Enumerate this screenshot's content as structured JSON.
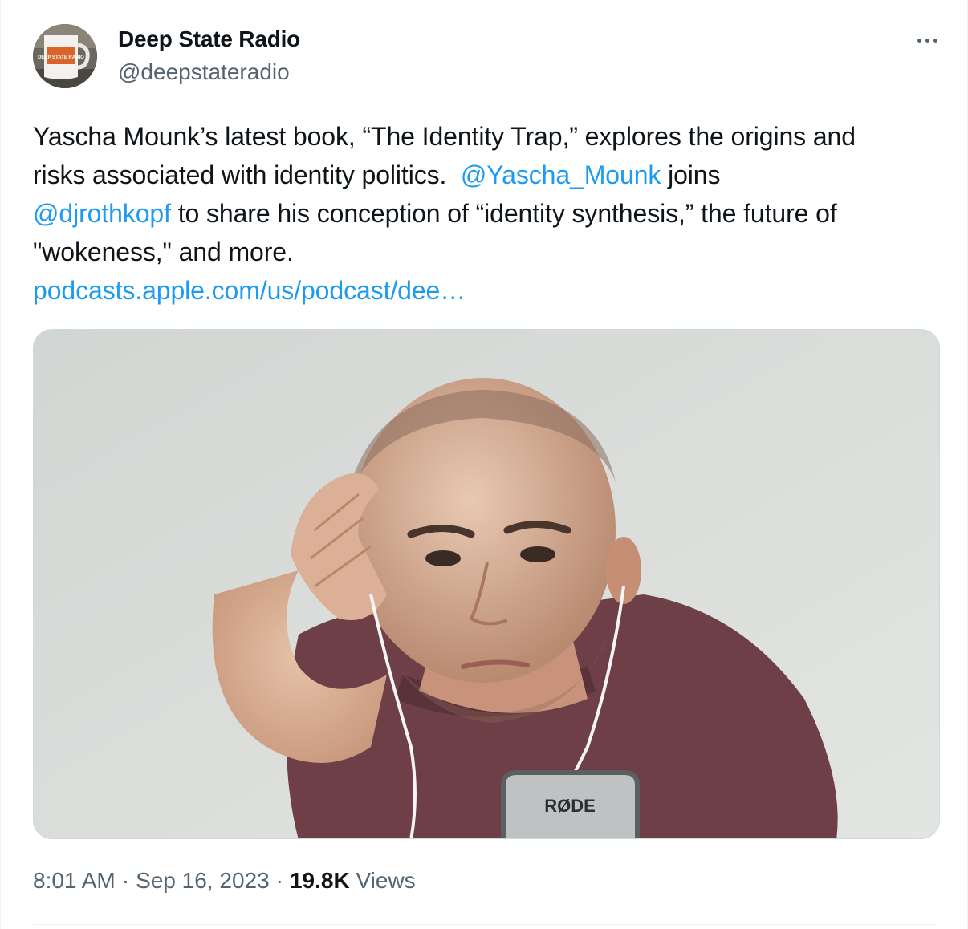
{
  "author": {
    "name": "Deep State Radio",
    "handle": "@deepstateradio",
    "avatar_icon": "mug-avatar-icon",
    "avatar_mug_text": "DEEP STATE RADIO"
  },
  "menu": {
    "icon": "more-options-icon"
  },
  "tweet": {
    "line1": "Yascha Mounk’s latest book, “The Identity Trap,” explores the origins and",
    "line2_text": "risks associated with identity politics. ",
    "mention1": "@Yascha_Mounk",
    "line2_after": " joins",
    "mention2": "@djrothkopf",
    "line3_after": " to share his conception of “identity synthesis,” the future of",
    "line4": "\"wokeness,\" and more.",
    "link": "podcasts.apple.com/us/podcast/dee…"
  },
  "media": {
    "kind": "video-still",
    "microphone_brand": "RØDE"
  },
  "meta": {
    "time": "8:01 AM",
    "date": "Sep 16, 2023",
    "separator": "·",
    "views_count": "19.8K",
    "views_label": "Views"
  },
  "colors": {
    "text": "#0f1419",
    "secondary": "#536471",
    "link": "#1d9bf0",
    "border": "#cfd9de"
  }
}
